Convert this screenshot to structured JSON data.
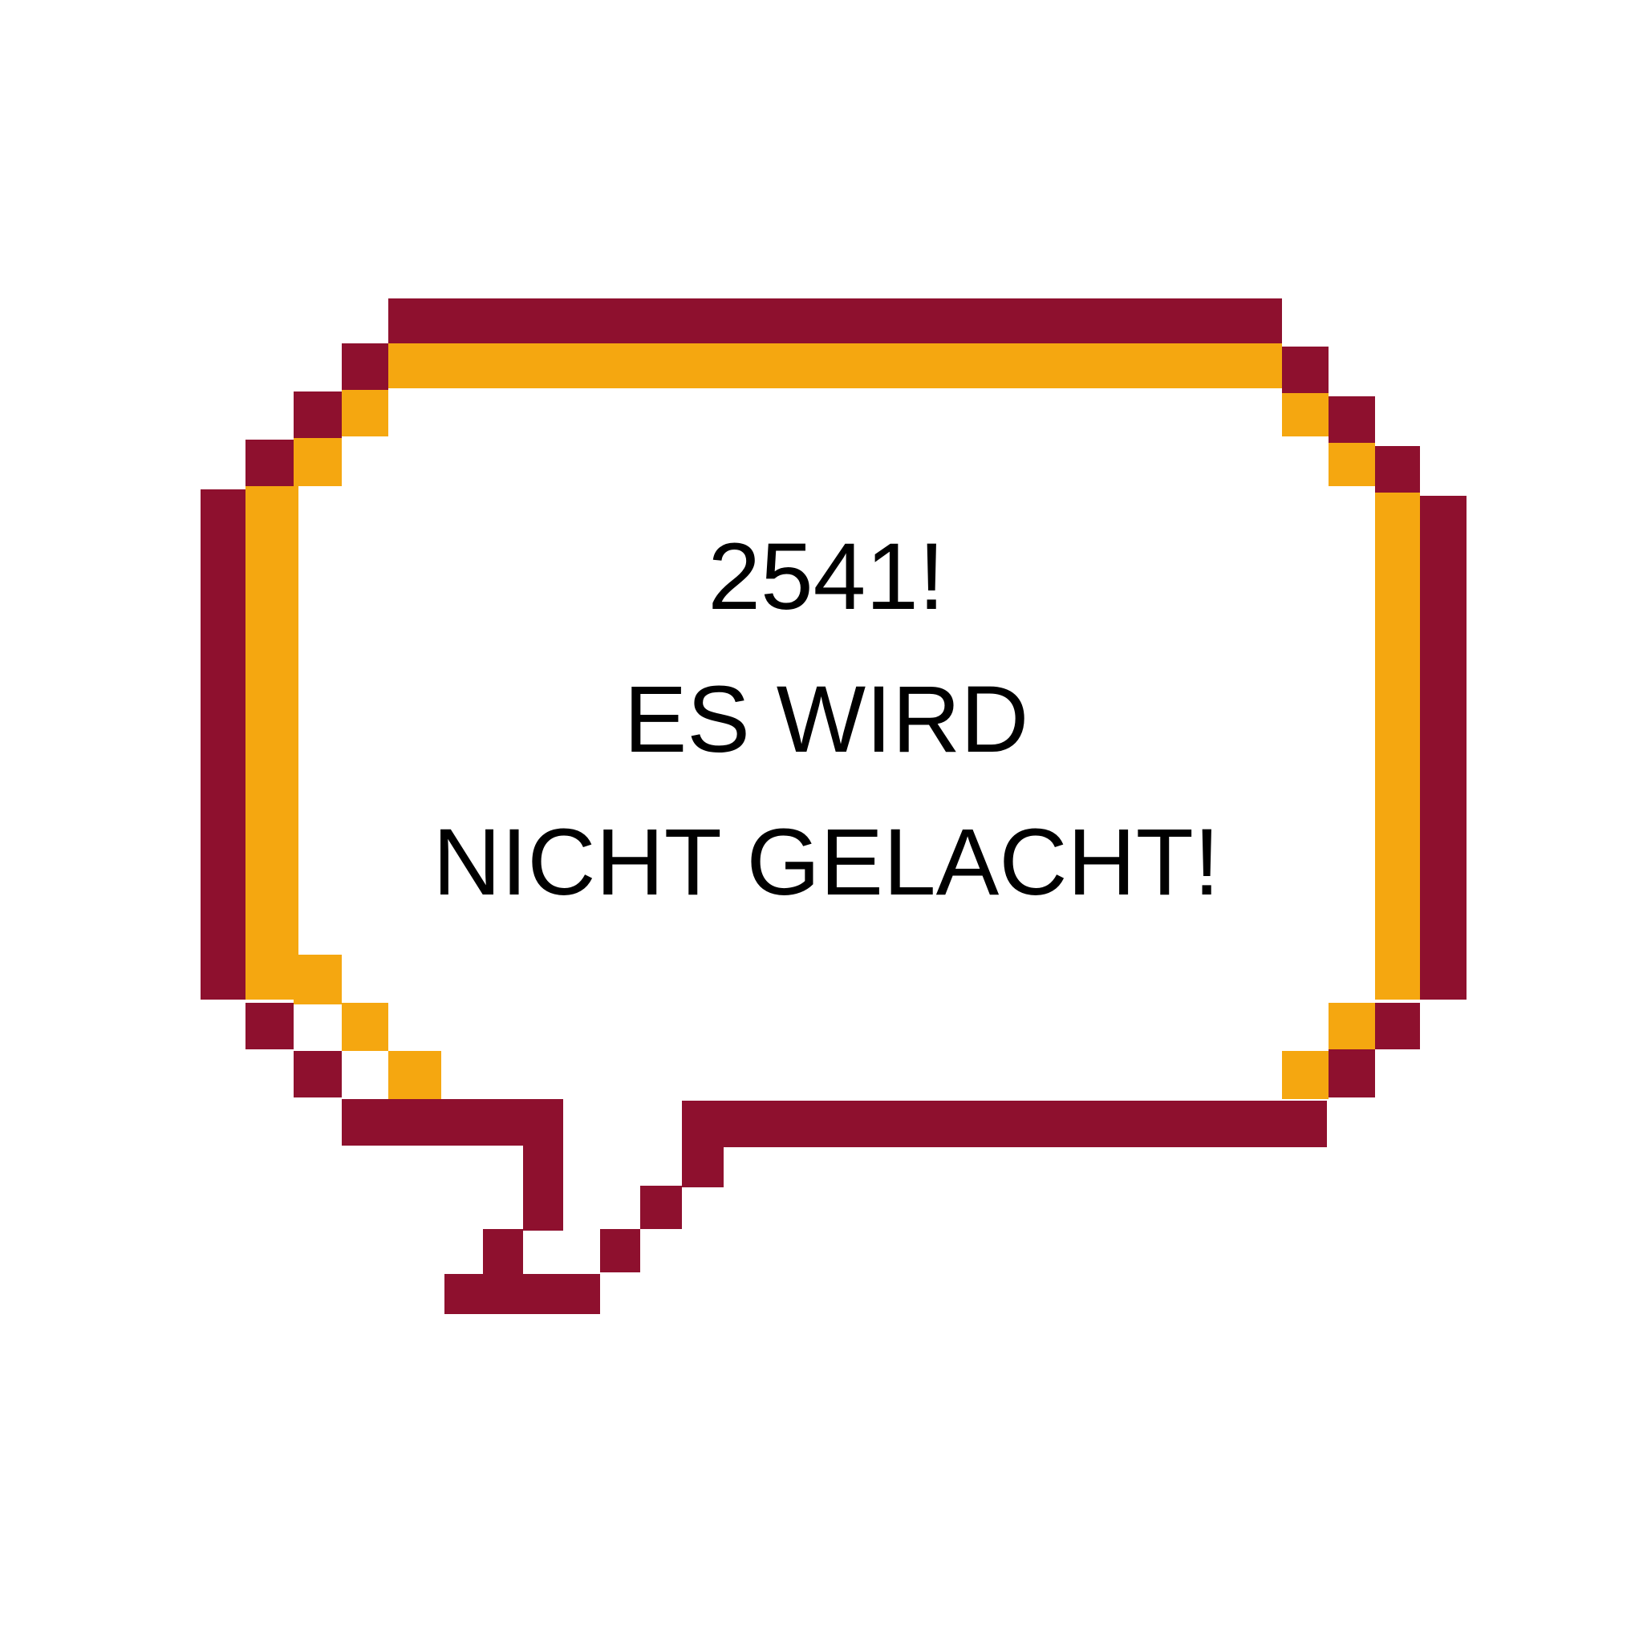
{
  "bubble": {
    "outer_color": "#8e102e",
    "inner_color": "#f5a710",
    "fill_color": "#ffffff"
  },
  "message": {
    "lines": [
      "2541!",
      "ES WIRD",
      "NICHT GELACHT!"
    ]
  }
}
